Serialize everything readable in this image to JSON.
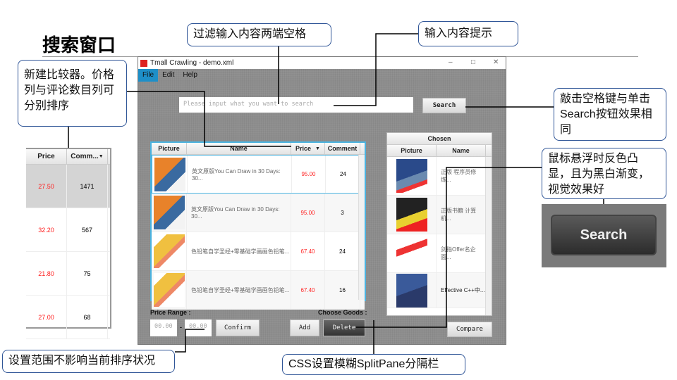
{
  "slide_title": "搜索窗口",
  "callouts": {
    "trim": "过滤输入内容两端空格",
    "hint": "输入内容提示",
    "comparator": "新建比较器。价格列与评论数目列可分别排序",
    "space_key": "敲击空格键与单击Search按钮效果相同",
    "hover": "鼠标悬浮时反色凸显，且为黑白渐变，视觉效果好",
    "range": "设置范围不影响当前排序状况",
    "splitpane": "CSS设置模糊SplitPane分隔栏"
  },
  "window": {
    "title": "Tmall Crawling - demo.xml",
    "menu": [
      "File",
      "Edit",
      "Help"
    ]
  },
  "search": {
    "placeholder": "Please input what you want to search",
    "button": "Search"
  },
  "goods_table": {
    "headers": [
      "Picture",
      "Name",
      "Price",
      "Comment"
    ],
    "rows": [
      {
        "name": "英文原版You Can Draw in 30 Days: 30...",
        "price": "95.00",
        "comment": "24"
      },
      {
        "name": "英文原版You Can Draw in 30 Days: 30...",
        "price": "95.00",
        "comment": "3"
      },
      {
        "name": "色铅笔自学圣经+零基础学画画色铅笔...",
        "price": "67.40",
        "comment": "24"
      },
      {
        "name": "色铅笔自学圣经+零基础学画画色铅笔...",
        "price": "67.40",
        "comment": "16"
      }
    ]
  },
  "chosen_table": {
    "title": "Chosen",
    "headers": [
      "Picture",
      "Name"
    ],
    "rows": [
      {
        "name": "正版 程序员修炼..."
      },
      {
        "name": "正版书籍 计算机..."
      },
      {
        "name": "剑指Offer名企面..."
      },
      {
        "name": "Effective C++中..."
      }
    ]
  },
  "price_range": {
    "label": "Price Range :",
    "min_placeholder": "00.00",
    "separator": "-",
    "max_placeholder": "00.00",
    "confirm": "Confirm"
  },
  "choose_goods": {
    "label": "Choose Goods :",
    "add": "Add",
    "delete": "Delete"
  },
  "compare": "Compare",
  "inset_table": {
    "headers": [
      "Price",
      "Comm..."
    ],
    "rows": [
      {
        "price": "27.50",
        "comment": "1471"
      },
      {
        "price": "32.20",
        "comment": "567"
      },
      {
        "price": "21.80",
        "comment": "75"
      },
      {
        "price": "27.00",
        "comment": "68"
      }
    ]
  },
  "hover_button": "Search",
  "colors": {
    "accent": "#1e8fc8",
    "price": "#ff2222",
    "callout_border": "#2f5597"
  }
}
